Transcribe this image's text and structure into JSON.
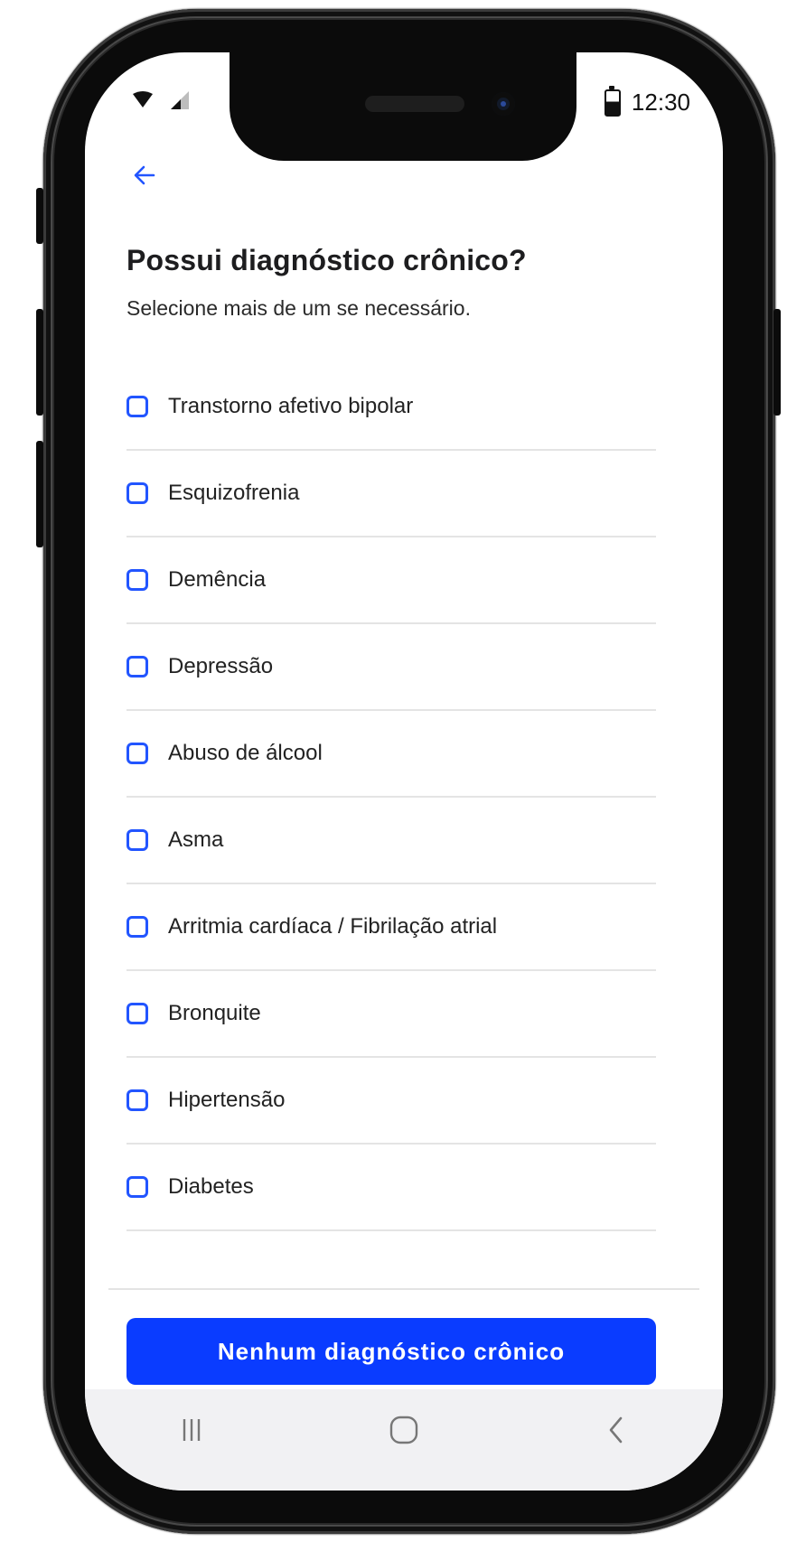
{
  "status_bar": {
    "time": "12:30",
    "icons": [
      "wifi-icon",
      "signal-icon",
      "battery-icon"
    ]
  },
  "header": {
    "back_icon": "arrow-left-icon",
    "title": "Possui diagnóstico crônico?",
    "subtitle": "Selecione mais de um se necessário."
  },
  "options": [
    {
      "label": "Transtorno afetivo bipolar",
      "checked": false
    },
    {
      "label": "Esquizofrenia",
      "checked": false
    },
    {
      "label": "Demência",
      "checked": false
    },
    {
      "label": "Depressão",
      "checked": false
    },
    {
      "label": "Abuso de álcool",
      "checked": false
    },
    {
      "label": "Asma",
      "checked": false
    },
    {
      "label": "Arritmia cardíaca / Fibrilação atrial",
      "checked": false
    },
    {
      "label": "Bronquite",
      "checked": false
    },
    {
      "label": "Hipertensão",
      "checked": false
    },
    {
      "label": "Diabetes",
      "checked": false
    }
  ],
  "footer": {
    "button_label": "Nenhum diagnóstico crônico"
  },
  "nav": {
    "icons": [
      "recent-apps-icon",
      "home-icon",
      "back-icon"
    ]
  },
  "colors": {
    "accent": "#0A3CFF",
    "checkbox_border": "#2255FF",
    "divider": "#E4E4E4",
    "navbar_bg": "#F1F1F3"
  }
}
